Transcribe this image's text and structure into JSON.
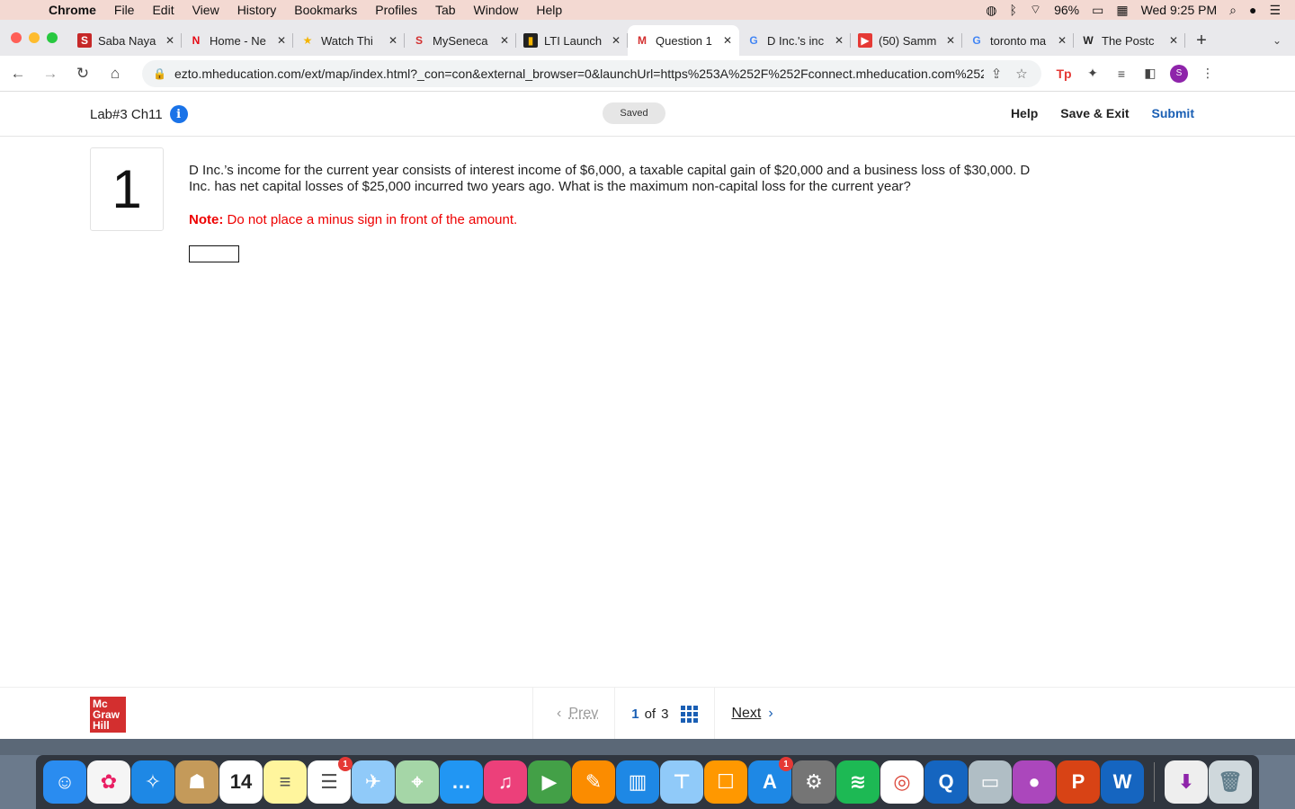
{
  "menubar": {
    "app": "Chrome",
    "items": [
      "File",
      "Edit",
      "View",
      "History",
      "Bookmarks",
      "Profiles",
      "Tab",
      "Window",
      "Help"
    ],
    "battery": "96%",
    "clock": "Wed 9:25 PM"
  },
  "tabs": [
    {
      "label": "Saba Naya",
      "fav": "S",
      "favbg": "#c62828",
      "favfg": "#fff"
    },
    {
      "label": "Home - Ne",
      "fav": "N",
      "favbg": "transparent",
      "favfg": "#e50914"
    },
    {
      "label": "Watch Thi",
      "fav": "★",
      "favbg": "transparent",
      "favfg": "#f4b400"
    },
    {
      "label": "MySeneca",
      "fav": "S",
      "favbg": "transparent",
      "favfg": "#d32f2f"
    },
    {
      "label": "LTI Launch",
      "fav": "▮",
      "favbg": "#222",
      "favfg": "#f4b400"
    },
    {
      "label": "Question 1",
      "fav": "M",
      "favbg": "#fff",
      "favfg": "#d32f2f",
      "active": true
    },
    {
      "label": "D Inc.'s inc",
      "fav": "G",
      "favbg": "transparent",
      "favfg": "#4285f4"
    },
    {
      "label": "(50) Samm",
      "fav": "▶",
      "favbg": "#e53935",
      "favfg": "#fff"
    },
    {
      "label": "toronto ma",
      "fav": "G",
      "favbg": "transparent",
      "favfg": "#4285f4"
    },
    {
      "label": "The Postc",
      "fav": "W",
      "favbg": "transparent",
      "favfg": "#222"
    }
  ],
  "toolbar": {
    "url": "ezto.mheducation.com/ext/map/index.html?_con=con&external_browser=0&launchUrl=https%253A%252F%252Fconnect.mheducation.com%252Fconn...",
    "profile_initial": "S",
    "tp_label": "Tp"
  },
  "header": {
    "title": "Lab#3 Ch11",
    "saved": "Saved",
    "help": "Help",
    "save_exit": "Save & Exit",
    "submit": "Submit"
  },
  "question": {
    "number": "1",
    "text": "D Inc.’s income for the current year consists of interest income of $6,000, a taxable capital gain of $20,000 and a business loss of $30,000. D Inc. has net capital losses of $25,000 incurred two years ago. What is the maximum non-capital loss for the current year?",
    "note_label": "Note:",
    "note_text": " Do not place a minus sign in front of the amount.",
    "answer_value": ""
  },
  "footer": {
    "logo_lines": [
      "Mc",
      "Graw",
      "Hill"
    ],
    "prev": "Prev",
    "current": "1",
    "of": "of",
    "total": "3",
    "next": "Next"
  },
  "dock": [
    {
      "name": "finder",
      "bg": "#2a8cf0",
      "glyph": "☺"
    },
    {
      "name": "photos",
      "bg": "#f5f5f5",
      "glyph": "✿",
      "fg": "#e91e63"
    },
    {
      "name": "safari",
      "bg": "#1e88e5",
      "glyph": "✧"
    },
    {
      "name": "contacts",
      "bg": "#c49a5a",
      "glyph": "☗"
    },
    {
      "name": "calendar",
      "bg": "#ffffff",
      "glyph": "14",
      "fg": "#222"
    },
    {
      "name": "notes",
      "bg": "#fff59d",
      "glyph": "≡",
      "fg": "#555"
    },
    {
      "name": "reminders",
      "bg": "#ffffff",
      "glyph": "☰",
      "fg": "#555",
      "badge": "1"
    },
    {
      "name": "preview",
      "bg": "#90caf9",
      "glyph": "✈"
    },
    {
      "name": "maps",
      "bg": "#a5d6a7",
      "glyph": "⌖"
    },
    {
      "name": "messages",
      "bg": "#2196f3",
      "glyph": "…"
    },
    {
      "name": "music",
      "bg": "#ec407a",
      "glyph": "♫"
    },
    {
      "name": "facetime",
      "bg": "#43a047",
      "glyph": "▶"
    },
    {
      "name": "pages",
      "bg": "#fb8c00",
      "glyph": "✎"
    },
    {
      "name": "numbers",
      "bg": "#1e88e5",
      "glyph": "▥"
    },
    {
      "name": "keynote",
      "bg": "#90caf9",
      "glyph": "⊤"
    },
    {
      "name": "books",
      "bg": "#ff9800",
      "glyph": "☐"
    },
    {
      "name": "appstore",
      "bg": "#1e88e5",
      "glyph": "A",
      "badge": "1"
    },
    {
      "name": "settings",
      "bg": "#757575",
      "glyph": "⚙"
    },
    {
      "name": "spotify",
      "bg": "#1db954",
      "glyph": "≋"
    },
    {
      "name": "chrome",
      "bg": "#ffffff",
      "glyph": "◎",
      "fg": "#db4437"
    },
    {
      "name": "quicktime",
      "bg": "#1565c0",
      "glyph": "Q"
    },
    {
      "name": "photos-2",
      "bg": "#b0bec5",
      "glyph": "▭"
    },
    {
      "name": "colorpicker",
      "bg": "#ab47bc",
      "glyph": "●"
    },
    {
      "name": "powerpoint",
      "bg": "#d84315",
      "glyph": "P"
    },
    {
      "name": "word",
      "bg": "#1565c0",
      "glyph": "W"
    },
    {
      "name": "downloads",
      "bg": "#eeeeee",
      "glyph": "⬇",
      "fg": "#8e24aa"
    },
    {
      "name": "trash",
      "bg": "#cfd8dc",
      "glyph": "🗑",
      "fg": "#607d8b"
    }
  ]
}
